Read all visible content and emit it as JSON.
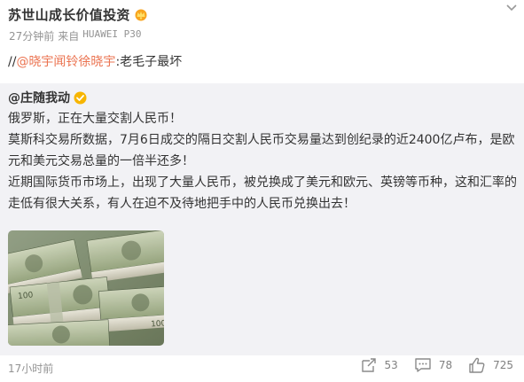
{
  "post": {
    "author": "苏世山成长价值投资",
    "time": "27分钟前",
    "source_prefix": "来自",
    "device": "HUAWEI P30",
    "repost_prefix": "//",
    "repost_mention": "@晓宇闻铃徐晓宇",
    "repost_comment": ":老毛子最坏"
  },
  "quoted": {
    "author": "@庄随我动",
    "paragraphs": [
      "俄罗斯，正在大量交割人民币！",
      "莫斯科交易所数据，7月6日成交的隔日交割人民币交易量达到创纪录的近2400亿卢布，是欧元和美元交易总量的一倍半还多！",
      "近期国际货币市场上，出现了大量人民币，被兑换成了美元和欧元、英镑等币种，这和汇率的走低有很大关系，有人在迫不及待地把手中的人民币兑换出去！"
    ],
    "time": "17小时前",
    "reposts": "53",
    "comments": "78",
    "likes": "725"
  },
  "icons": {
    "badge": "crown-badge-icon",
    "verified": "vip-verified-icon",
    "more": "chevron-down-icon",
    "repost": "repost-icon",
    "comment": "comment-icon",
    "like": "thumbs-up-icon"
  },
  "colors": {
    "mention": "#eb7350",
    "quoted_bg": "#f2f2f5",
    "meta_text": "#939393",
    "verified": "#f7b500"
  }
}
